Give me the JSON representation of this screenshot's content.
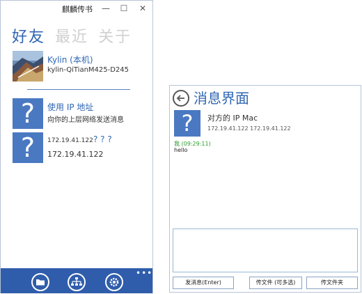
{
  "left_window": {
    "title": "麒麟传书",
    "controls": {
      "minimize": "—",
      "maximize": "☐",
      "close": "✕"
    },
    "tabs": [
      {
        "label": "好友",
        "active": true
      },
      {
        "label": "最近",
        "active": false
      },
      {
        "label": "关于",
        "active": false
      }
    ],
    "self_contact": {
      "name": "Kylin (本机)",
      "host": "kylin-QiTianM425-D245"
    },
    "ip_contact": {
      "name": "使用 IP 地址",
      "desc": "向你的上层网络发送消息"
    },
    "unknown_contact": {
      "name_prefix": "172.19.41.122",
      "name_suffix": "? ? ?",
      "ip": "172.19.41.122"
    },
    "bottom_more": "•••",
    "colors": {
      "accent": "#2f66b3",
      "bottom_bar": "#2f5dab",
      "avatar_box": "#4a79c2"
    }
  },
  "right_window": {
    "title": "消息界面",
    "peer": {
      "name": "对方的 IP Mac",
      "ip_mac": "172.19.41.122 172.19.41.122"
    },
    "message": {
      "meta": "我 (09:29:11)",
      "text": "hello"
    },
    "buttons": {
      "send": "发消息(Enter)",
      "send_file": "传文件 (可多选)",
      "send_folder": "传文件夹"
    }
  }
}
